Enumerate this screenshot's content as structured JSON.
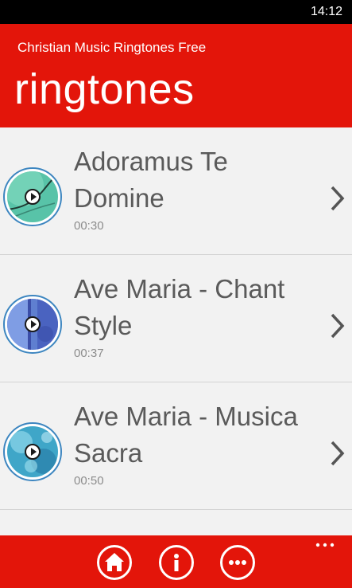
{
  "status_bar": {
    "time": "14:12"
  },
  "header": {
    "app_title": "Christian Music Ringtones Free",
    "page_title": "ringtones"
  },
  "ringtones": [
    {
      "title": "Adoramus Te Domine",
      "duration": "00:30"
    },
    {
      "title": "Ave Maria - Chant Style",
      "duration": "00:37"
    },
    {
      "title": "Ave Maria - Musica Sacra",
      "duration": "00:50"
    }
  ],
  "app_bar": {
    "buttons": [
      "home-icon",
      "info-icon",
      "more-icon"
    ],
    "menu_icon": "ellipsis-icon"
  },
  "colors": {
    "accent": "#e3150a",
    "background": "#f2f2f2",
    "text": "#5a5a5a",
    "subtext": "#8c8c8c",
    "thumb_border": "#3d86c0"
  }
}
